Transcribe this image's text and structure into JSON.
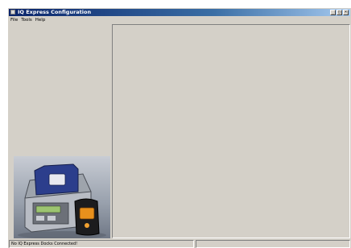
{
  "window": {
    "title": "IQ Express Configuration",
    "icon": "app-icon",
    "buttons": [
      "minimize-icon",
      "maximize-icon",
      "close-icon"
    ]
  },
  "menu": {
    "items": [
      {
        "label": "File"
      },
      {
        "label": "Tools"
      },
      {
        "label": "Help"
      }
    ]
  },
  "left_pane": {
    "image": "iq-express-dock-with-gas-detector-photo"
  },
  "status_bar": {
    "message": "No IQ Express Docks Connected!",
    "panel2": ""
  }
}
